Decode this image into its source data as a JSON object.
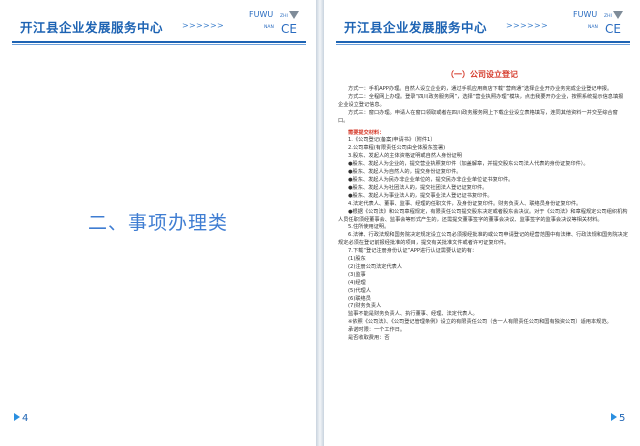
{
  "header": {
    "title": "开江县企业发展服务中心",
    "arrows": ">>>>>>",
    "logo": {
      "fuwu": "FUWU",
      "zhi": "ZHI",
      "nan": "NAN",
      "ce": "CE"
    }
  },
  "left_page": {
    "chapter_title": "二、事项办理类",
    "page_number": "4"
  },
  "right_page": {
    "section_title": "（一）公司设立登记",
    "methods": [
      "方式一：手机APP办理。自然人设立企业的，通过手机应用商店下载“营商通”选择企业开办业务完成企业登记申报。",
      "方式二：全程网上办理。登录“四川政务服务网”，选择“营业执照办理”模块，点击我要开办企业，按照系统提示信息填报企业设立登记信息。",
      "方式三：窗口办理。申请人在窗口领取或者在四川政务服务网上下载企业设立表格填写，连同其他资料一并交至综合窗口。"
    ],
    "materials_heading": "需要提交材料：",
    "materials": [
      "1.《公司登记(备案)申请书》（附件1）",
      "2.公司章程(有限责任公司由全体股东签署)",
      "3.股东、发起人的主体资格证明或自然人身份证明",
      "●股东、发起人为企业的，提交营业执照复印件（加盖解章，并提交股东公司法人代表的身份证复印件）。",
      "●股东、发起人为自然人的，提交身份证复印件。",
      "●股东、发起人为民办非企业单位的，提交民办非企业单位证书复印件。",
      "●股东、发起人为社团法人的，提交社团法人登记证复印件。",
      "●股东、发起人为事业法人的，提交事业法人登记证书复印件。",
      "4.法定代表人、董事、监事、经理的任职文件，及身份证复印件。财务负责人、联络员身份证复印件。",
      "●根据《公司法》和公司章程规定，有限责任公司提交股东决定或者股东会决议。对于《公司法》和章程规定公司组织机构人员任职须经董事会、监事会等形式产生的，还需提交董事签字的董事会决议、监事签字的监事会决议等相关材料。",
      "5.住所使用证明。",
      "6.法律、行政法规和国务院决定规定设立公司必须报经批准的或公司申请登记的经营范围中有法律、行政法规和国务院决定规定必须在登记前报经批准的项目，提交有关批准文件或者许可证复印件。",
      "7.下载“登记注册身份认证”APP进行认证需要认证的有：",
      "(1)股东",
      "(2)注册公司法定代表人",
      "(3)监事",
      "(4)经理",
      "(5)代理人",
      "(6)联络员",
      "(7)财务负责人",
      "监事不能是财务负责人、执行董事、经理、法定代表人。",
      "※依照《公司法》、《公司登记管理条例》设立的有限责任公司（含一人有限责任公司和国有独资公司）适用本规范。",
      "承诺时限：一个工作日。",
      "是否收取费用：否"
    ],
    "page_number": "5"
  },
  "colors": {
    "brand_blue": "#1d63b3",
    "heading_red": "#d53a2a",
    "chapter_blue": "#3f7dd2"
  }
}
